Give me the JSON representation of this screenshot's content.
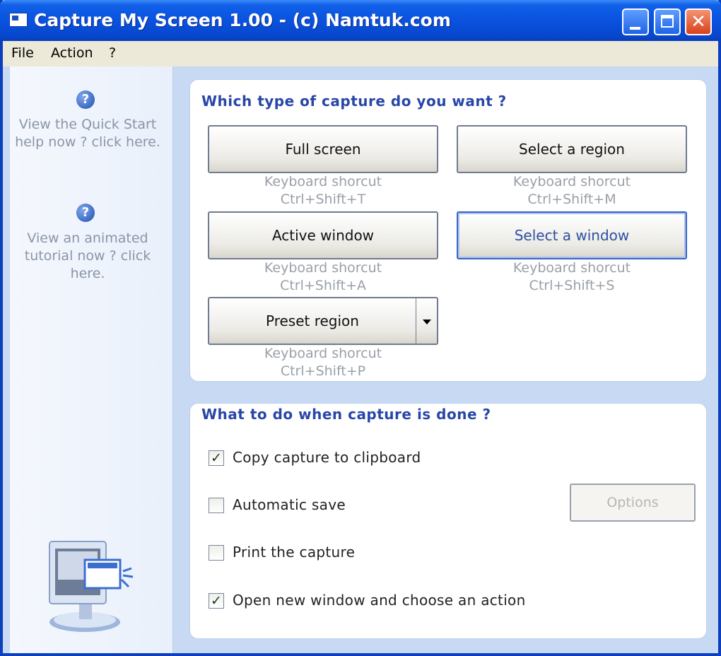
{
  "window": {
    "title": "Capture My Screen 1.00 - (c) Namtuk.com"
  },
  "menu": [
    {
      "label": "File"
    },
    {
      "label": "Action"
    },
    {
      "label": "?"
    }
  ],
  "sidebar": {
    "help_links": [
      {
        "icon": "help-icon",
        "text": "View the Quick Start help now ? click here."
      },
      {
        "icon": "help-icon",
        "text": "View an animated tutorial now ? click here."
      }
    ],
    "illustration": "monitor-capture-icon"
  },
  "capture_panel": {
    "title": "Which type of capture do you want ?",
    "buttons": [
      {
        "label": "Full screen",
        "shortcut_label": "Keyboard shorcut",
        "shortcut": "Ctrl+Shift+T"
      },
      {
        "label": "Select a region",
        "shortcut_label": "Keyboard shorcut",
        "shortcut": "Ctrl+Shift+M"
      },
      {
        "label": "Active window",
        "shortcut_label": "Keyboard shorcut",
        "shortcut": "Ctrl+Shift+A"
      },
      {
        "label": "Select a window",
        "shortcut_label": "Keyboard shorcut",
        "shortcut": "Ctrl+Shift+S"
      },
      {
        "label": "Preset region",
        "shortcut_label": "Keyboard shorcut",
        "shortcut": "Ctrl+Shift+P"
      }
    ]
  },
  "done_panel": {
    "title": "What to do when capture is done ?",
    "options": [
      {
        "label": "Copy capture to clipboard",
        "checked": true
      },
      {
        "label": "Automatic save",
        "checked": false
      },
      {
        "label": "Print the capture",
        "checked": false
      },
      {
        "label": "Open new window and choose an action",
        "checked": true
      }
    ],
    "options_button": "Options"
  },
  "colors": {
    "titlebar": "#0a52df",
    "panel_title": "#2846a8",
    "client_bg": "#c8d9f3"
  }
}
